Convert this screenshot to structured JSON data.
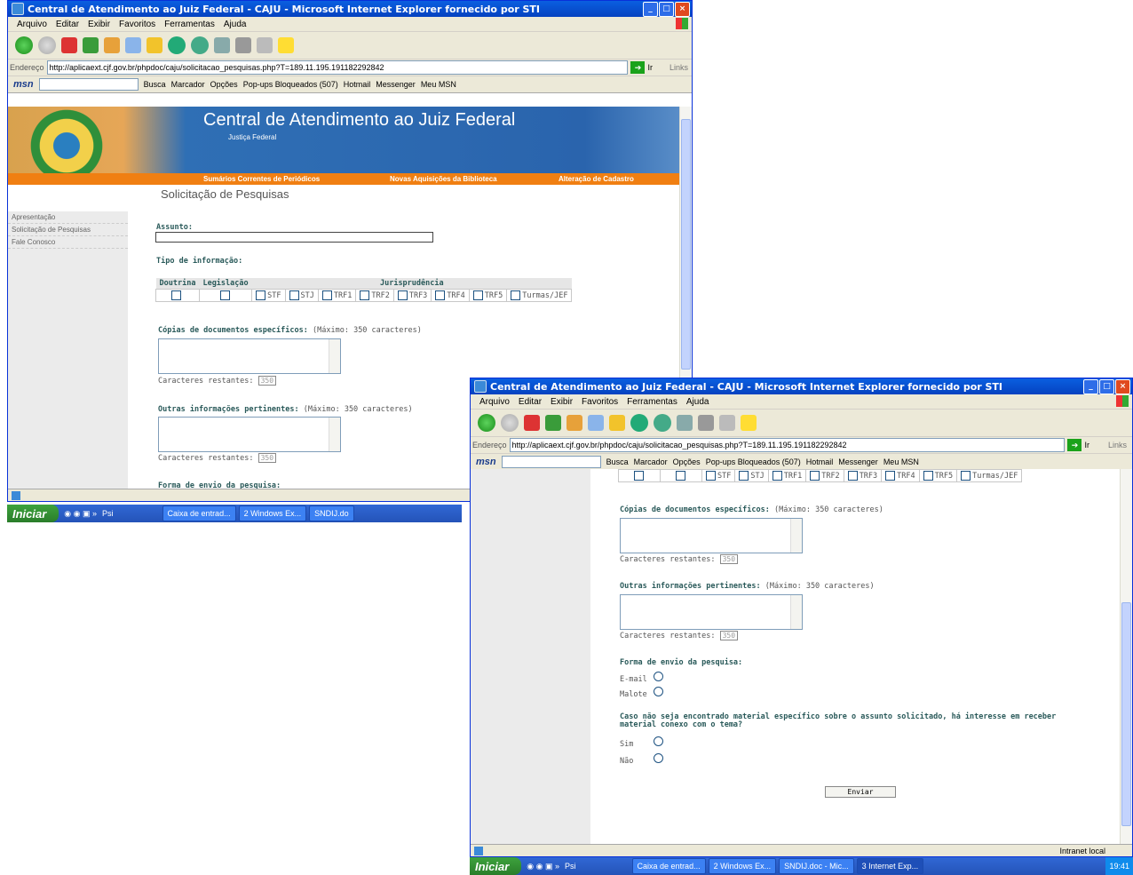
{
  "browser": {
    "title": "Central de Atendimento ao Juiz Federal - CAJU - Microsoft Internet Explorer fornecido por STI",
    "menu": [
      "Arquivo",
      "Editar",
      "Exibir",
      "Favoritos",
      "Ferramentas",
      "Ajuda"
    ],
    "address_label": "Endereço",
    "url1": "http://aplicaext.cjf.gov.br/phpdoc/caju/solicitacao_pesquisas.php?T=189.11.195.191182292842",
    "url2": "http://aplicaext.cjf.gov.br/phpdoc/caju/solicitacao_pesquisas.php?T=189.11.195.191182292842",
    "go_label": "Ir",
    "links_label": "Links",
    "msn_bar": {
      "logo": "msn",
      "busca": "Busca",
      "marcador": "Marcador",
      "opcoes": "Opções",
      "popups": "Pop-ups Bloqueados (507)",
      "hotmail": "Hotmail",
      "messenger": "Messenger",
      "meu_msn": "Meu MSN"
    },
    "status_zone": "Intranet local"
  },
  "site": {
    "header_title": "Central de Atendimento ao Juiz Federal",
    "header_sub": "Justiça Federal",
    "nav": [
      "Sumários Correntes de Periódicos",
      "Novas Aquisições da Biblioteca",
      "Alteração de Cadastro"
    ],
    "page_title": "Solicitação de Pesquisas",
    "side_menu": [
      "Apresentação",
      "Solicitação de Pesquisas",
      "Fale Conosco"
    ]
  },
  "form": {
    "assunto_label": "Assunto:",
    "tipo_label": "Tipo de informação:",
    "tipo_headers": {
      "doutrina": "Doutrina",
      "legislacao": "Legislação",
      "jurisprudencia": "Jurisprudência"
    },
    "juris_options": [
      "STF",
      "STJ",
      "TRF1",
      "TRF2",
      "TRF3",
      "TRF4",
      "TRF5",
      "Turmas/JEF"
    ],
    "copias_label": "Cópias de documentos específicos:",
    "copias_hint": "(Máximo: 350 caracteres)",
    "outras_label": "Outras informações pertinentes:",
    "outras_hint": "(Máximo: 350 caracteres)",
    "restantes_label": "Caracteres restantes:",
    "restantes_value": "350",
    "envio_label": "Forma de envio da pesquisa:",
    "envio_options": [
      "E-mail",
      "Malote"
    ],
    "material_label_1": "Caso não seja encontrado material específico sobre o assunto solicitado, há interesse em receber",
    "material_label_2": "material conexo com o tema?",
    "material_options": [
      "Sim",
      "Não"
    ],
    "submit": "Enviar"
  },
  "taskbar": {
    "start": "Iniciar",
    "items_back": [
      "Psi",
      "Caixa de entrad...",
      "2 Windows Ex...",
      "SNDIJ.do"
    ],
    "items_front": [
      "Psi",
      "Caixa de entrad...",
      "2 Windows Ex...",
      "SNDIJ.doc - Mic...",
      "3 Internet Exp..."
    ],
    "clock": "19:41"
  }
}
